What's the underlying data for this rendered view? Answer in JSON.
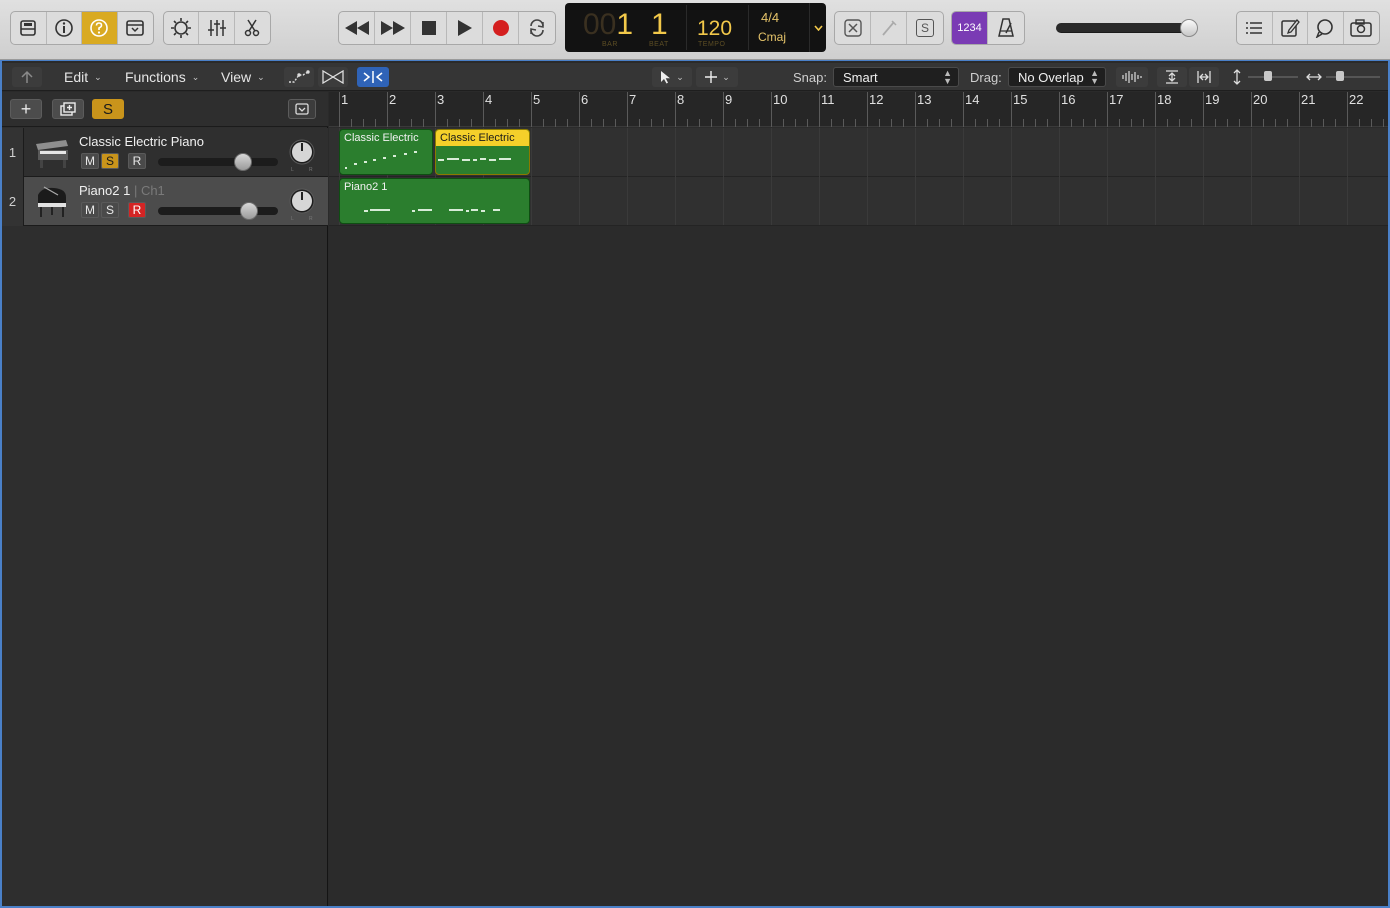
{
  "controlbar": {
    "left_buttons": [
      {
        "name": "library-button",
        "icon": "library-icon",
        "active": false
      },
      {
        "name": "inspector-button",
        "icon": "info-icon",
        "active": false
      },
      {
        "name": "quick-help-button",
        "icon": "question-icon",
        "active": true
      },
      {
        "name": "toolbar-button",
        "icon": "toolbar-icon",
        "active": false
      }
    ],
    "middle_buttons": [
      {
        "name": "smart-controls-button",
        "icon": "smart-controls-icon"
      },
      {
        "name": "mixer-button",
        "icon": "mixer-icon"
      },
      {
        "name": "editors-button",
        "icon": "scissors-icon"
      }
    ],
    "transport": [
      "rewind-icon",
      "fast-forward-icon",
      "stop-icon",
      "play-icon",
      "record-icon",
      "cycle-icon"
    ],
    "lcd": {
      "bar_dim": "00",
      "bar": "1",
      "beat": "1",
      "bar_label": "BAR",
      "beat_label": "BEAT",
      "tempo": "120",
      "tempo_label": "TEMPO",
      "signature": "4/4",
      "key": "Cmaj"
    },
    "mode_buttons": [
      {
        "name": "replace-button",
        "icon": "replace-icon"
      },
      {
        "name": "tuner-button",
        "icon": "tuner-icon"
      },
      {
        "name": "solo-mode-button",
        "icon": "solo-icon",
        "label": "S"
      },
      {
        "name": "count-in-button",
        "label": "1234",
        "active": true
      },
      {
        "name": "metronome-button",
        "icon": "metronome-icon"
      }
    ],
    "master_volume": 0.94,
    "right_buttons": [
      "list-editors-icon",
      "note-pad-icon",
      "loop-browser-icon",
      "browsers-icon"
    ]
  },
  "toolbar": {
    "back_icon": "back-arrow-icon",
    "edit_label": "Edit",
    "functions_label": "Functions",
    "view_label": "View",
    "snap_label": "Snap:",
    "snap_value": "Smart",
    "drag_label": "Drag:",
    "drag_value": "No Overlap"
  },
  "track_header": {
    "add_label": "+",
    "solo_label": "S"
  },
  "tracks": [
    {
      "number": "1",
      "name": "Classic Electric Piano",
      "channel": "",
      "mute": "M",
      "solo": "S",
      "record": "R",
      "solo_on": true,
      "record_on": false,
      "volume": 0.71,
      "icon": "electric-piano-icon"
    },
    {
      "number": "2",
      "name": "Piano2 1",
      "channel": "| Ch1",
      "mute": "M",
      "solo": "S",
      "record": "R",
      "solo_on": false,
      "record_on": true,
      "volume": 0.76,
      "icon": "grand-piano-icon"
    }
  ],
  "ruler": {
    "bars": [
      "1",
      "2",
      "3",
      "4",
      "5",
      "6",
      "7",
      "8",
      "9",
      "10",
      "11",
      "12",
      "13",
      "14",
      "15",
      "16",
      "17",
      "18",
      "19",
      "20",
      "21",
      "22"
    ]
  },
  "regions": [
    {
      "track": 1,
      "name": "Classic Electric",
      "selected": false
    },
    {
      "track": 1,
      "name": "Classic Electric",
      "selected": true
    },
    {
      "track": 2,
      "name": "Piano2 1",
      "selected": false
    }
  ],
  "colors": {
    "region_green": "#2b7e2e",
    "region_selected_header": "#f5d02a",
    "accent_gold": "#d9aa22",
    "record_red": "#d42424",
    "window_border_blue": "#4a80c8"
  }
}
